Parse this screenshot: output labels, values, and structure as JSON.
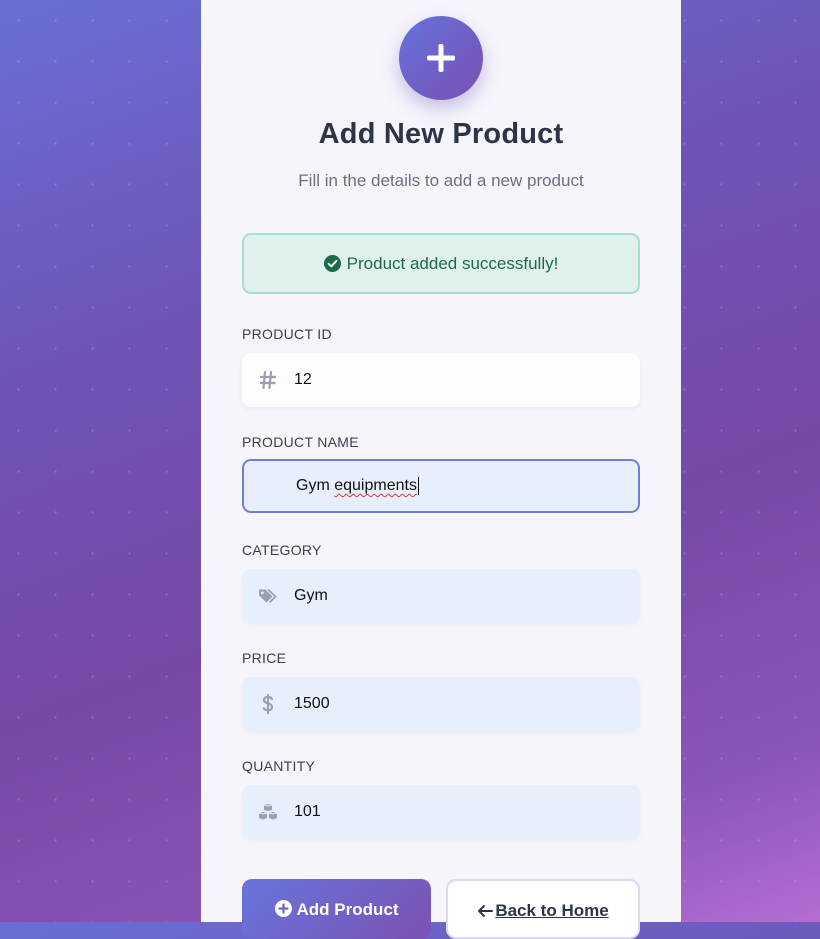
{
  "header": {
    "title": "Add New Product",
    "subtitle": "Fill in the details to add a new product"
  },
  "alert": {
    "message": "Product added successfully!"
  },
  "form": {
    "product_id": {
      "label": "PRODUCT ID",
      "value": "12",
      "icon": "hash-icon"
    },
    "product_name": {
      "label": "PRODUCT NAME",
      "value_word1": "Gym",
      "value_word2": "equipments"
    },
    "category": {
      "label": "CATEGORY",
      "value": "Gym",
      "icon": "tags-icon"
    },
    "price": {
      "label": "PRICE",
      "value": "1500",
      "icon": "dollar-icon"
    },
    "quantity": {
      "label": "QUANTITY",
      "value": "101",
      "icon": "cubes-icon"
    }
  },
  "buttons": {
    "add_product": "Add Product",
    "back_home": "Back to Home"
  },
  "colors": {
    "accent": "#6d7fd6",
    "success_bg": "#e0f1ed",
    "success_text": "#1b6b4a"
  }
}
